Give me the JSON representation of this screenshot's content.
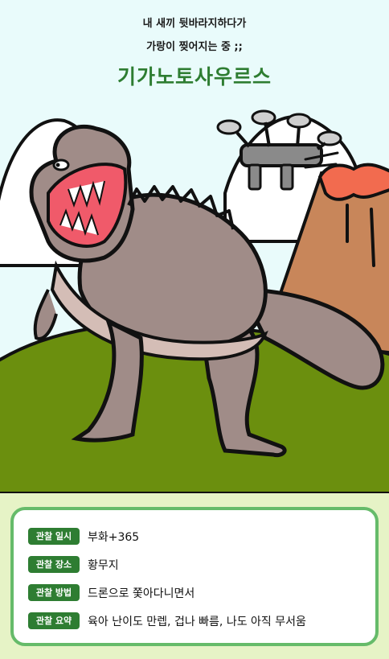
{
  "header": {
    "line1": "내 새끼 뒷바라지하다가",
    "line2": "가랑이 찢어지는 중 ;;",
    "title": "기가노토사우르스"
  },
  "illustration": {
    "subject": "dinosaur",
    "props": [
      "drone-icon",
      "volcano-icon"
    ],
    "colors": {
      "sky": "#e9fbfb",
      "grass": "#6b8f0e",
      "dino_body": "#a08c88",
      "dino_belly": "#d4bdb6",
      "mouth": "#f05a6a",
      "volcano": "#c8865a",
      "lava": "#f26b4f",
      "drone": "#8a8a8a"
    }
  },
  "info": {
    "rows": [
      {
        "label": "관찰 일시",
        "value": "부화+365"
      },
      {
        "label": "관찰 장소",
        "value": "황무지"
      },
      {
        "label": "관찰 방법",
        "value": "드론으로 쫓아다니면서"
      },
      {
        "label": "관찰 요약",
        "value": "육아 난이도 만렙, 겁나 빠름, 나도 아직 무서움"
      }
    ],
    "colors": {
      "badge": "#2e7d32",
      "border": "#66bb6a",
      "background": "#e6f3c6"
    }
  }
}
